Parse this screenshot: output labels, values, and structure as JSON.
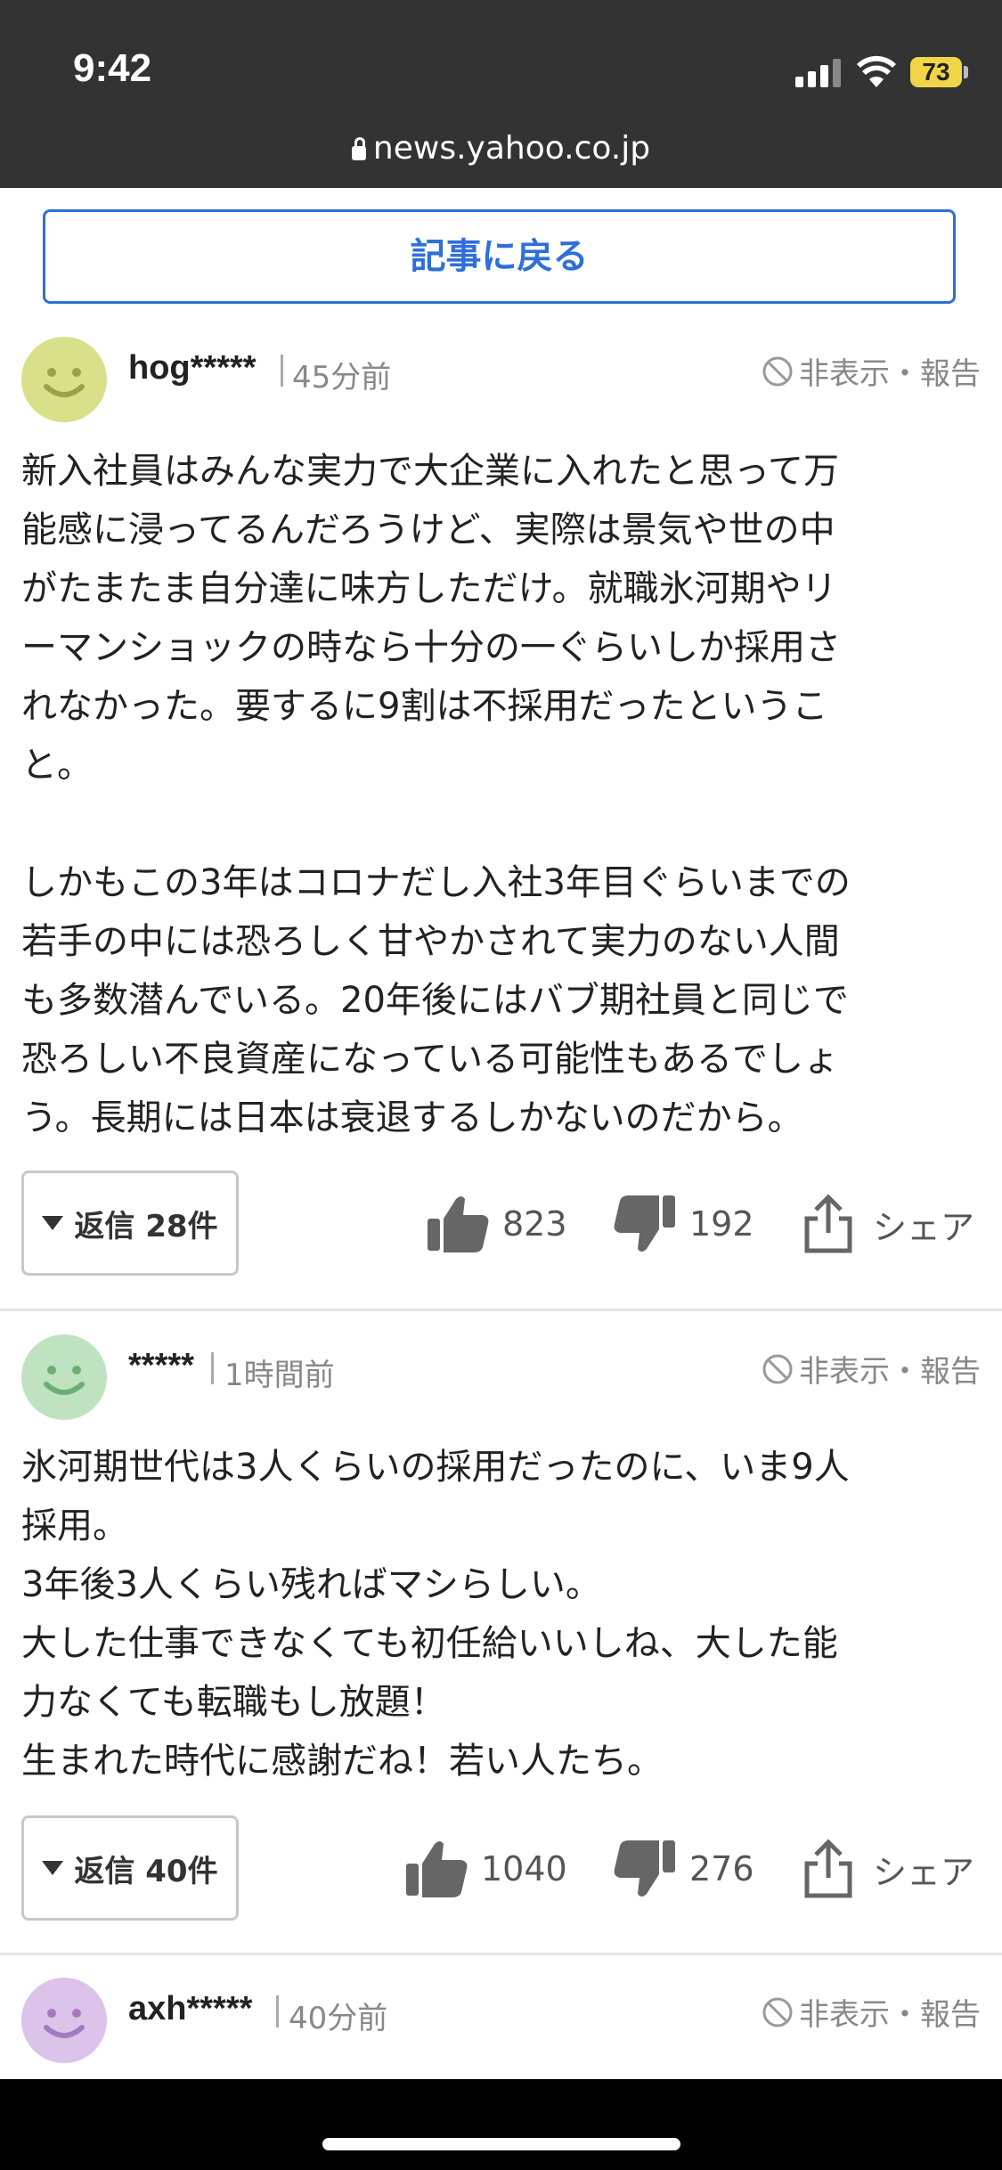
{
  "status_bar": {
    "time": "9:42",
    "battery": "73"
  },
  "browser": {
    "url": "news.yahoo.co.jp"
  },
  "back_button": "記事に戻る",
  "hide_report": "非表示・報告",
  "share_label": "シェア",
  "comments": [
    {
      "user": "hog*****",
      "time": "45分前",
      "avatar_color": "#d8e08a",
      "text": "新入社員はみんな実力で大企業に入れたと思って万\n能感に浸ってるんだろうけど、実際は景気や世の中\nがたまたま自分達に味方しただけ。就職氷河期やリ\nーマンショックの時なら十分の一ぐらいしか採用さ\nれなかった。要するに9割は不採用だったというこ\nと。\n\nしかもこの3年はコロナだし入社3年目ぐらいまでの\n若手の中には恐ろしく甘やかされて実力のない人間\nも多数潜んでいる。20年後にはバブ期社員と同じで\n恐ろしい不良資産になっている可能性もあるでしょ\nう。長期には日本は衰退するしかないのだから。",
      "replies": "返信 28件",
      "likes": "823",
      "dislikes": "192"
    },
    {
      "user": "*****",
      "time": "1時間前",
      "avatar_color": "#bfe3c0",
      "text": "氷河期世代は3人くらいの採用だったのに、いま9人\n採用。\n3年後3人くらい残ればマシらしい。\n大した仕事できなくても初任給いいしね、大した能\n力なくても転職もし放題！\n生まれた時代に感謝だね！若い人たち。",
      "replies": "返信 40件",
      "likes": "1040",
      "dislikes": "276"
    },
    {
      "user": "axh*****",
      "time": "40分前",
      "avatar_color": "#dcc3ea"
    }
  ]
}
